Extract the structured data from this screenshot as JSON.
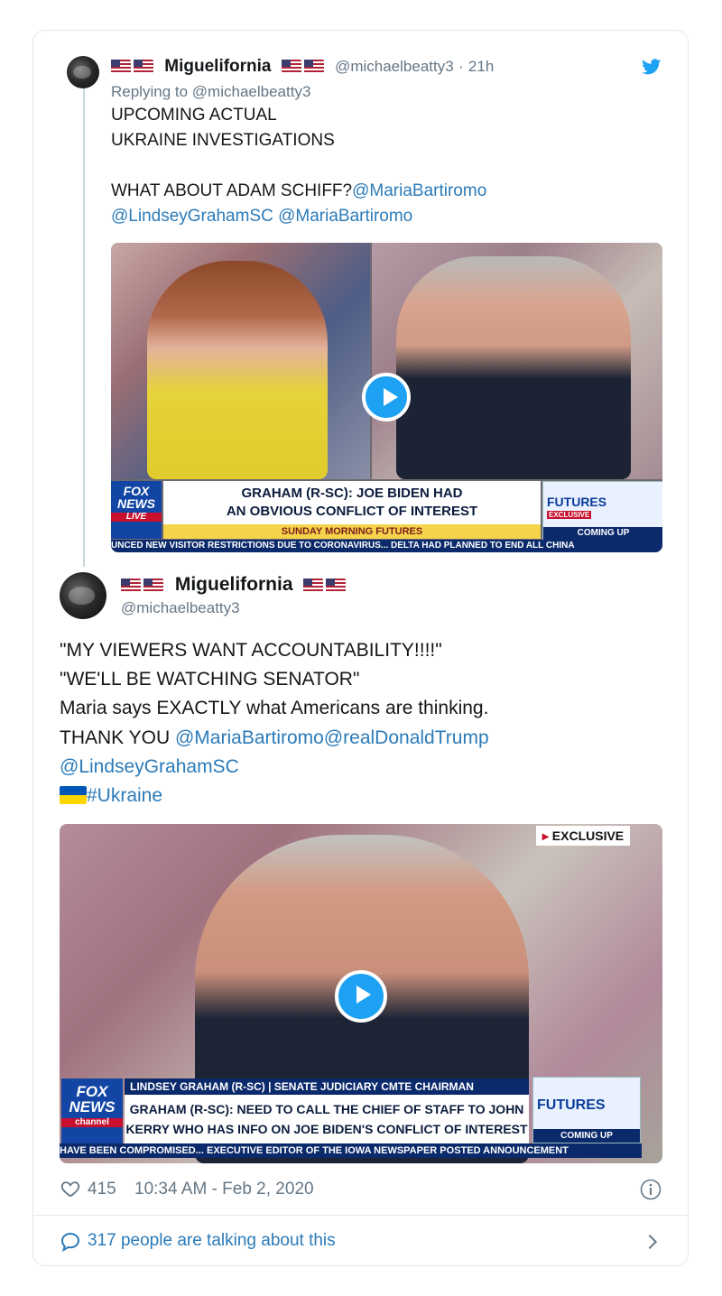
{
  "reply": {
    "display_name": "Miguelifornia",
    "handle": "@michaelbeatty3",
    "time": "21h",
    "replying_to_prefix": "Replying to",
    "replying_to_handle": "@michaelbeatty3",
    "line1": "UPCOMING ACTUAL",
    "line2": "UKRAINE INVESTIGATIONS",
    "line3_text": "WHAT ABOUT ADAM SCHIFF?",
    "line3_mention": "@MariaBartiromo",
    "line4_mention1": "@LindseyGrahamSC",
    "line4_mention2": "@MariaBartiromo",
    "video": {
      "banner_line1": "GRAHAM (R-SC): JOE BIDEN HAD",
      "banner_line2": "AN OBVIOUS CONFLICT OF INTEREST",
      "show_name": "SUNDAY MORNING FUTURES",
      "logo_line1": "FOX",
      "logo_line2": "NEWS",
      "logo_line3": "LIVE",
      "futures_label": "FUTURES",
      "exclusive_small": "EXCLUSIVE",
      "coming_up": "COMING UP",
      "ticker": "UNCED NEW VISITOR RESTRICTIONS DUE TO CORONAVIRUS... DELTA HAD PLANNED TO END ALL CHINA"
    }
  },
  "main": {
    "display_name": "Miguelifornia",
    "handle": "@michaelbeatty3",
    "line1": "\"MY VIEWERS WANT ACCOUNTABILITY!!!!\"",
    "line2": "\"WE'LL BE WATCHING SENATOR\"",
    "line3": "Maria says EXACTLY what Americans are thinking.",
    "line4_text": "THANK YOU",
    "line4_mention1": "@MariaBartiromo",
    "line4_mention2": "@realDonaldTrump",
    "line5_mention": "@LindseyGrahamSC",
    "hashtag": "#Ukraine",
    "video": {
      "exclusive": "EXCLUSIVE",
      "lower_third_name": "LINDSEY GRAHAM (R-SC) | SENATE JUDICIARY CMTE CHAIRMAN",
      "banner_line1": "GRAHAM (R-SC): NEED TO CALL THE CHIEF OF STAFF TO JOHN",
      "banner_line2": "KERRY WHO HAS INFO ON JOE BIDEN'S CONFLICT OF INTEREST",
      "logo_line1": "FOX",
      "logo_line2": "NEWS",
      "logo_line3": "channel",
      "futures_label": "FUTURES",
      "coming_up": "COMING UP",
      "ticker": "HAVE BEEN COMPROMISED... EXECUTIVE EDITOR OF THE IOWA NEWSPAPER POSTED ANNOUNCEMENT"
    },
    "likes": "415",
    "timestamp": "10:34 AM - Feb 2, 2020",
    "talking": "317 people are talking about this"
  },
  "colors": {
    "link": "#2b7bb9",
    "twitter_blue": "#1da1f2",
    "muted": "#657786"
  },
  "icons": [
    "twitter-bird-icon",
    "heart-icon",
    "info-icon",
    "comment-bubble-icon",
    "chevron-right-icon",
    "play-icon",
    "flag-usa-icon",
    "flag-ukraine-icon"
  ]
}
